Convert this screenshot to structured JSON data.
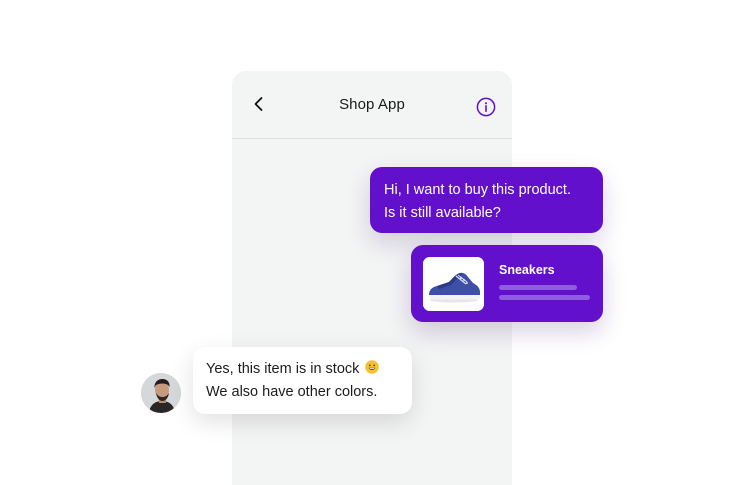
{
  "header": {
    "title": "Shop App",
    "back_icon": "chevron-left-icon",
    "info_icon": "info-circle-icon"
  },
  "outgoing_message": {
    "line1": "Hi, I want to buy this product.",
    "line2": "Is it still available?"
  },
  "product_card": {
    "name": "Sneakers",
    "image": "blue-sneaker"
  },
  "incoming_message": {
    "line1": "Yes, this item is in stock",
    "emoji": "grinning-face",
    "line2": "We also have other colors."
  },
  "colors": {
    "accent": "#6210cc",
    "phone_background": "#f3f4f4",
    "bubble_in_background": "#ffffff"
  }
}
